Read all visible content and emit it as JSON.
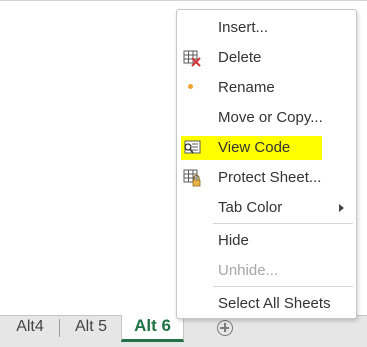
{
  "tabs": [
    {
      "label": "Alt4"
    },
    {
      "label": "Alt 5"
    },
    {
      "label": "Alt 6"
    }
  ],
  "menu": {
    "items": [
      {
        "label": "Insert...",
        "icon": "none"
      },
      {
        "label": "Delete",
        "icon": "delete-sheet-icon"
      },
      {
        "label": "Rename",
        "icon": "rename-dot-icon"
      },
      {
        "label": "Move or Copy...",
        "icon": "none"
      },
      {
        "label": "View Code",
        "icon": "view-code-icon"
      },
      {
        "label": "Protect Sheet...",
        "icon": "protect-sheet-icon"
      },
      {
        "label": "Tab Color",
        "icon": "submenu-arrow"
      },
      {
        "label": "Hide",
        "icon": "none"
      },
      {
        "label": "Unhide...",
        "icon": "none"
      },
      {
        "label": "Select All Sheets",
        "icon": "none"
      }
    ]
  },
  "colors": {
    "active_tab": "#217346",
    "highlight": "#ffff00",
    "delete_x": "#d13438",
    "rename_dot": "#f0a030"
  }
}
